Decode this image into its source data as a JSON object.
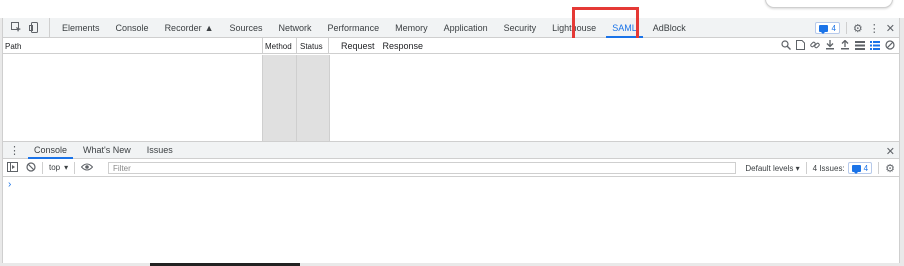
{
  "main_tabs": [
    "Elements",
    "Console",
    "Recorder",
    "Sources",
    "Network",
    "Performance",
    "Memory",
    "Application",
    "Security",
    "Lighthouse",
    "SAML",
    "AdBlock"
  ],
  "active_tab": "SAML",
  "issues_count": "4",
  "saml_panel": {
    "col_path": "Path",
    "col_method": "Method",
    "col_status": "Status",
    "tab_request": "Request",
    "tab_response": "Response"
  },
  "drawer": {
    "tabs": [
      "Console",
      "What's New",
      "Issues"
    ],
    "active": "Console"
  },
  "console": {
    "context": "top",
    "filter_placeholder": "Filter",
    "levels": "Default levels",
    "issues_label": "4 Issues:",
    "issues_count": "4",
    "prompt": "›"
  },
  "colors": {
    "accent": "#1a73e8",
    "highlight": "#e53935"
  }
}
